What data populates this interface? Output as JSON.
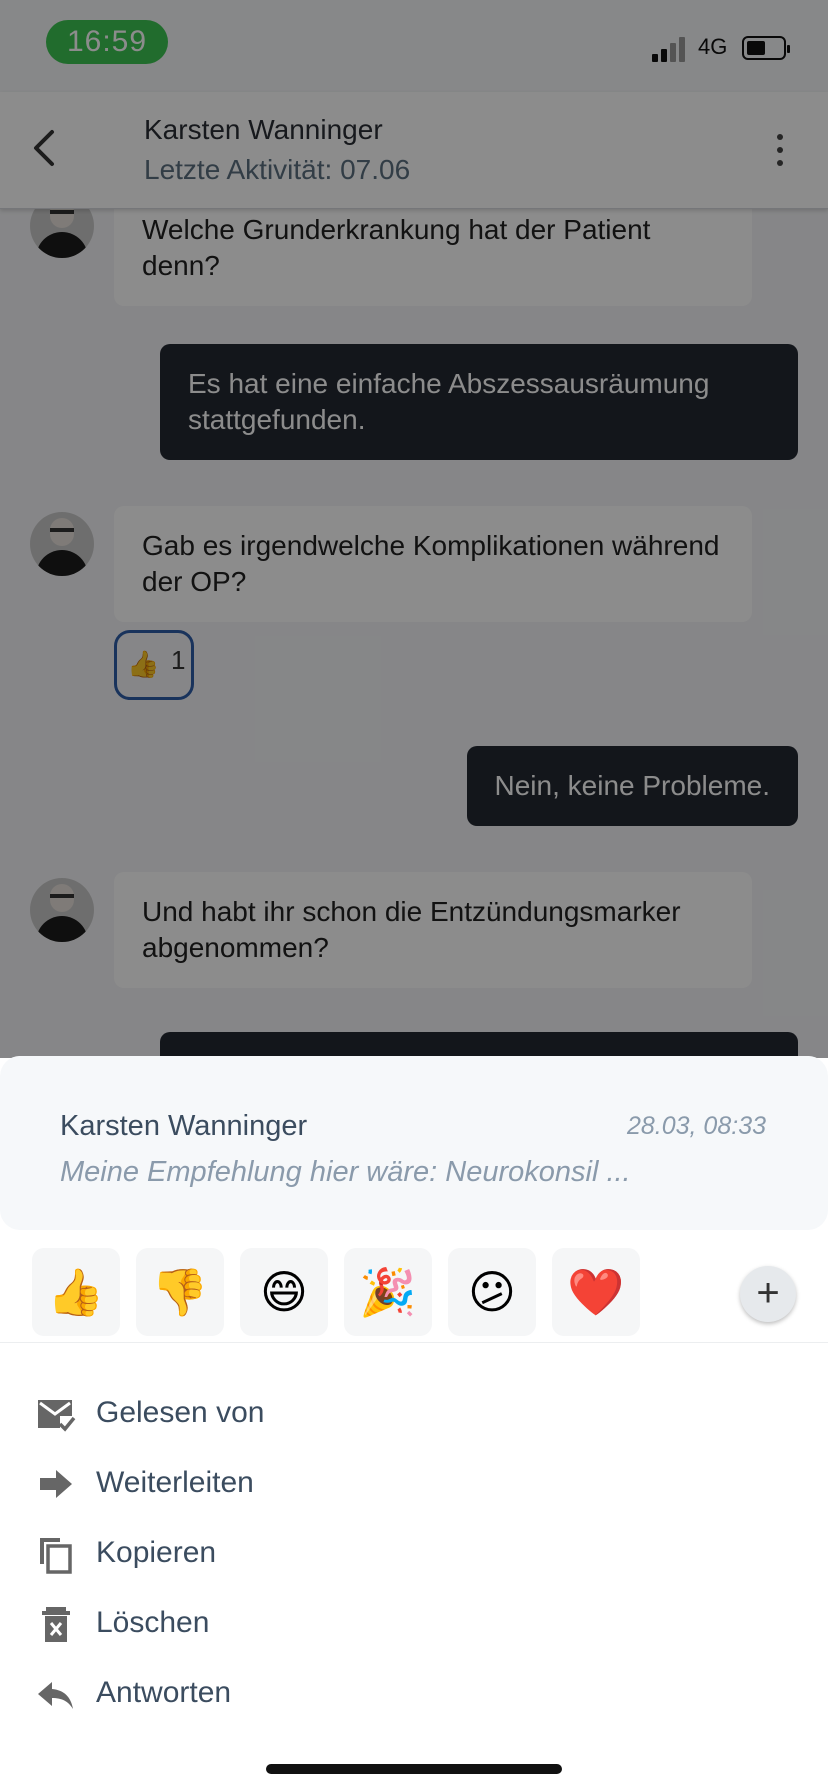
{
  "status_bar": {
    "time": "16:59",
    "network": "4G"
  },
  "header": {
    "name": "Karsten Wanninger",
    "subtitle": "Letzte Aktivität: 07.06"
  },
  "messages": [
    {
      "type": "in",
      "text": "Welche Grunderkrankung hat der Patient denn?"
    },
    {
      "type": "out",
      "text": "Es hat eine einfache Abszessausräumung stattgefunden."
    },
    {
      "type": "in",
      "text": "Gab es irgendwelche Komplikationen während der OP?",
      "reaction": {
        "emoji": "👍",
        "count": "1"
      }
    },
    {
      "type": "out",
      "text": "Nein, keine Probleme."
    },
    {
      "type": "in",
      "text": "Und habt ihr schon die Entzündungsmarker abgenommen?"
    }
  ],
  "preview": {
    "name": "Karsten Wanninger",
    "time": "28.03, 08:33",
    "text": "Meine Empfehlung hier wäre: Neurokonsil ..."
  },
  "emojis": [
    "👍",
    "👎",
    "😄",
    "🎉",
    "😕",
    "❤️"
  ],
  "plus_label": "+",
  "actions": [
    {
      "label": "Gelesen von",
      "icon": "mail-check-icon"
    },
    {
      "label": "Weiterleiten",
      "icon": "forward-arrow-icon"
    },
    {
      "label": "Kopieren",
      "icon": "copy-icon"
    },
    {
      "label": "Löschen",
      "icon": "trash-icon"
    },
    {
      "label": "Antworten",
      "icon": "reply-icon"
    }
  ]
}
